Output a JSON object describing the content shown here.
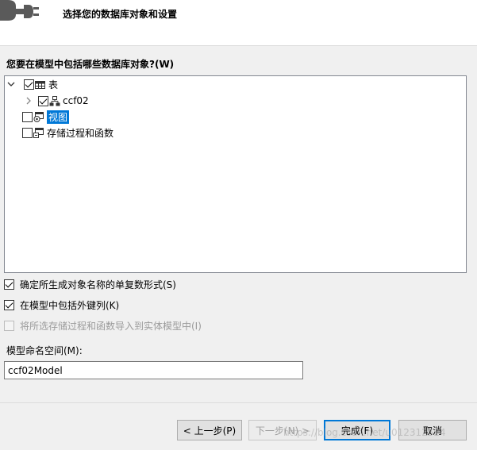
{
  "header": {
    "title": "选择您的数据库对象和设置",
    "icon": "database-plug-icon"
  },
  "prompt": "您要在模型中包括哪些数据库对象?(W)",
  "tree": {
    "nodes": [
      {
        "label": "表",
        "checked": true,
        "expanded": true,
        "icon": "table-icon"
      },
      {
        "label": "ccf02",
        "checked": true,
        "expanded": false,
        "icon": "schema-icon"
      },
      {
        "label": "视图",
        "checked": false,
        "selected": true,
        "icon": "view-icon"
      },
      {
        "label": "存储过程和函数",
        "checked": false,
        "icon": "stored-procedure-icon"
      }
    ]
  },
  "options": {
    "pluralize": {
      "label": "确定所生成对象名称的单复数形式(S)",
      "checked": true
    },
    "foreign_keys": {
      "label": "在模型中包括外键列(K)",
      "checked": true
    },
    "import_procs": {
      "label": "将所选存储过程和函数导入到实体模型中(I)",
      "checked": false,
      "disabled": true
    }
  },
  "namespace": {
    "label": "模型命名空间(M):",
    "value": "ccf02Model"
  },
  "buttons": {
    "back": "< 上一步(P)",
    "next": "下一步(N) >",
    "finish": "完成(F)",
    "cancel": "取消"
  },
  "watermark": "https://blog.csdn.net/u012312524",
  "colors": {
    "selection": "#0078d7",
    "primary_border": "#0078d7"
  }
}
